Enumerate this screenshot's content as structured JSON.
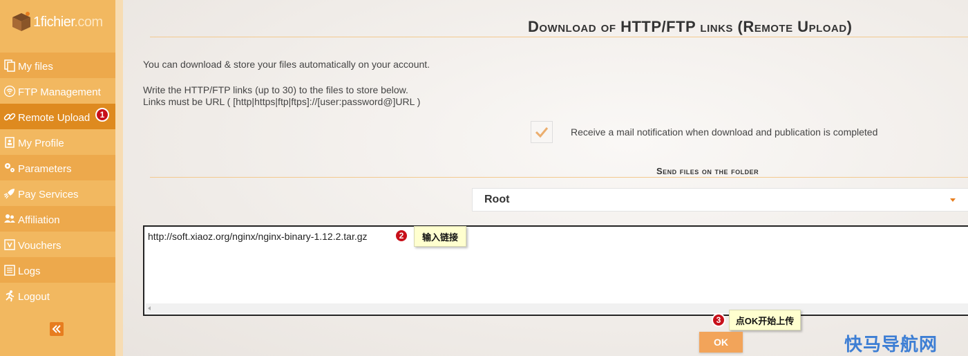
{
  "brand": {
    "logo_text": "1fichier",
    "logo_suffix": ".com"
  },
  "sidebar": {
    "items": [
      {
        "label": "My files",
        "icon": "files-icon"
      },
      {
        "label": "FTP Management",
        "icon": "wifi-icon"
      },
      {
        "label": "Remote Upload",
        "icon": "link-icon",
        "active": true
      },
      {
        "label": "My Profile",
        "icon": "profile-icon"
      },
      {
        "label": "Parameters",
        "icon": "gears-icon"
      },
      {
        "label": "Pay Services",
        "icon": "rocket-icon"
      },
      {
        "label": "Affiliation",
        "icon": "users-icon"
      },
      {
        "label": "Vouchers",
        "icon": "voucher-icon"
      },
      {
        "label": "Logs",
        "icon": "list-icon"
      },
      {
        "label": "Logout",
        "icon": "run-icon"
      }
    ],
    "collapse_icon": "double-chevron-left-icon"
  },
  "main": {
    "title": "Download of HTTP/FTP links (Remote Upload)",
    "intro": "You can download & store your files automatically on your account.",
    "instructions_1": "Write the HTTP/FTP links (up to 30) to the files to store below.",
    "instructions_2": "Links must be URL ( [http|https|ftp|ftps]://[user:password@]URL )",
    "notification_label": "Receive a mail notification when download and publication is completed",
    "notification_checked": true,
    "folder_heading": "Send files on the folder",
    "folder_selected": "Root",
    "links_value": "http://soft.xiaoz.org/nginx/nginx-binary-1.12.2.tar.gz",
    "ok_label": "OK"
  },
  "annotations": {
    "step1": "1",
    "step2": "2",
    "step2_text": "输入链接",
    "step3": "3",
    "step3_text": "点OK开始上传"
  },
  "watermark": "快马导航网",
  "colors": {
    "sidebar": "#f2b860",
    "sidebar_active": "#de8a1f",
    "accent": "#e87e1e",
    "ok_button": "#f2a45a",
    "badge": "#c8101a"
  }
}
